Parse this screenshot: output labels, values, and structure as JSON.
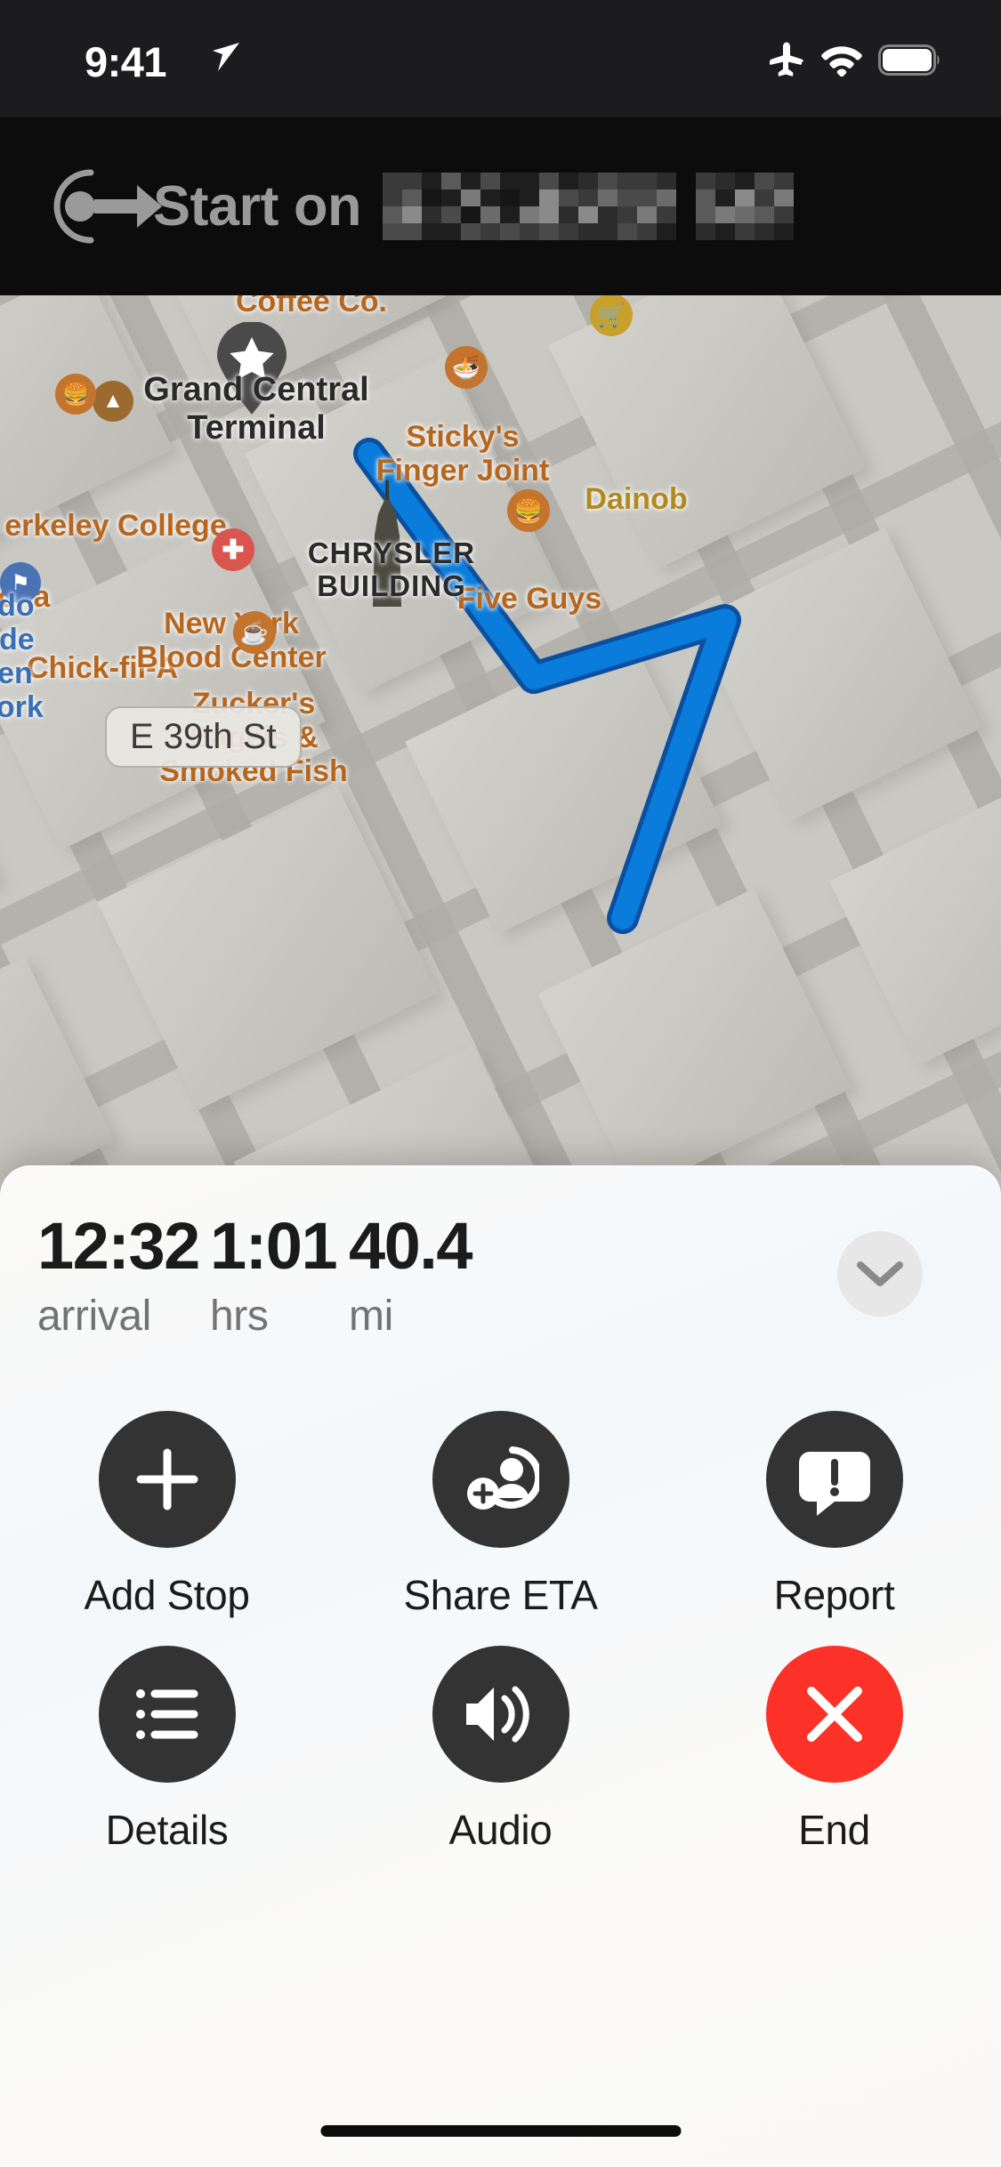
{
  "status_bar": {
    "time": "9:41",
    "icons": [
      "location-arrow-icon",
      "airplane-mode-icon",
      "wifi-icon",
      "battery-icon"
    ]
  },
  "nav_banner": {
    "instruction": "Start on",
    "street_name_redacted": true,
    "maneuver_icon": "depart-icon",
    "background_color": "#0c0c0c",
    "text_color": "#9a9a9a"
  },
  "map": {
    "route_color": "#0a7cdb",
    "route_casing_color": "#0b4fa0",
    "pois": [
      {
        "name": "Black Fox\nCoffee Co.",
        "label": "Coffee Co.",
        "type": "cafe"
      },
      {
        "name": "Berkeley College",
        "label": "erkeley College",
        "type": "school"
      },
      {
        "name": "cha",
        "label": "cha",
        "type": "restaurant"
      },
      {
        "name": "Chick-fil-A",
        "label": "Chick-fil-A",
        "type": "restaurant"
      },
      {
        "name": "Grand Central Terminal",
        "label": "Grand Central\nTerminal",
        "type": "landmark"
      },
      {
        "name": "Sticky's Finger Joint",
        "label": "Sticky's\nFinger Joint",
        "type": "restaurant"
      },
      {
        "name": "Dainobu",
        "label": "Dainob",
        "type": "grocery"
      },
      {
        "name": "Five Guys",
        "label": "Five Guys",
        "type": "restaurant"
      },
      {
        "name": "New York Blood Center",
        "label": "New York\nBlood Center",
        "type": "medical"
      },
      {
        "name": "Zucker's Bagels & Smoked Fish",
        "label": "Zucker's\nBagels &\nSmoked Fish",
        "type": "cafe"
      },
      {
        "name": "Consulado General de Mexico en Nueva York",
        "label": "ulado\nral de\nco en\na York",
        "type": "government"
      },
      {
        "name": "CHRYSLER BUILDING",
        "label": "CHRYSLER\nBUILDING",
        "type": "landmark"
      }
    ],
    "street_label": "E 39th St",
    "label_color": "#b5661f",
    "landmark_label_color": "#2a2a2a"
  },
  "sheet": {
    "stats": [
      {
        "value": "12:32",
        "label": "arrival"
      },
      {
        "value": "1:01",
        "label": "hrs"
      },
      {
        "value": "40.4",
        "label": "mi"
      }
    ],
    "collapse_icon": "chevron-down-icon",
    "actions": [
      {
        "label": "Add Stop",
        "icon": "plus-icon",
        "style": "dark"
      },
      {
        "label": "Share ETA",
        "icon": "person-add-icon",
        "style": "dark"
      },
      {
        "label": "Report",
        "icon": "report-bubble-icon",
        "style": "dark"
      },
      {
        "label": "Details",
        "icon": "list-bullet-icon",
        "style": "dark"
      },
      {
        "label": "Audio",
        "icon": "speaker-wave-icon",
        "style": "dark"
      },
      {
        "label": "End",
        "icon": "close-x-icon",
        "style": "danger"
      }
    ],
    "danger_color": "#fc3128",
    "button_color": "#333333"
  }
}
